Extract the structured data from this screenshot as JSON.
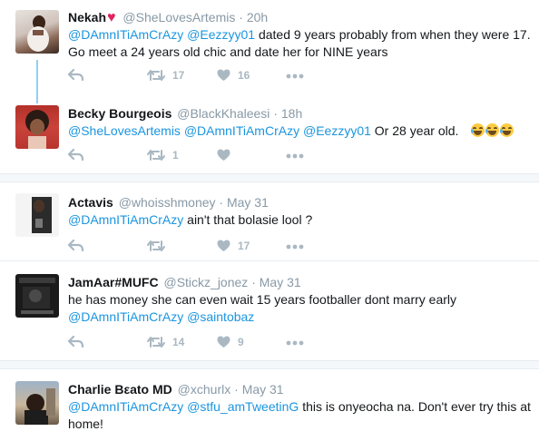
{
  "tweets": [
    {
      "name": "Nekah",
      "name_suffix": "♥",
      "handle": "@SheLovesArtemis",
      "dot": "·",
      "time": "20h",
      "mention1": "@DAmnITiAmCrAzy",
      "mention2": "@Eezzyy01",
      "text": " dated 9 years probably from when they were 17. Go meet a 24 years old chic and date her for NINE years",
      "retweets": "17",
      "likes": "16"
    },
    {
      "name": "Becky Bourgeois",
      "handle": "@BlackKhaleesi",
      "dot": "·",
      "time": "18h",
      "mention1": "@SheLovesArtemis",
      "mention2": "@DAmnITiAmCrAzy",
      "mention3": "@Eezzyy01",
      "text": " Or 28 year old.",
      "retweets": "1",
      "likes": ""
    },
    {
      "name": "Actavis",
      "handle": "@whoisshmoney",
      "dot": "·",
      "time": "May 31",
      "mention1": "@DAmnITiAmCrAzy",
      "text": " ain't that bolasie lool ?",
      "retweets": "",
      "likes": "17"
    },
    {
      "name": "JamAar#MUFC",
      "handle": "@Stickz_jonez",
      "dot": "·",
      "time": "May 31",
      "text": "he has money she can even wait 15 years footballer dont marry early",
      "mention1": "@DAmnITiAmCrAzy",
      "mention2": "@saintobaz",
      "retweets": "14",
      "likes": "9"
    },
    {
      "name": "Charlie Bεato MD",
      "handle": "@xchurlx",
      "dot": "·",
      "time": "May 31",
      "mention1": "@DAmnITiAmCrAzy",
      "mention2": "@stfu_amTweetinG",
      "text": " this is  onyeocha na. Don't ever try this at home!"
    }
  ],
  "colors": {
    "mention": "#1b95e0",
    "heart": "#e0245e",
    "muted": "#8899a6",
    "icon": "#aab8c2"
  },
  "icons": [
    "reply-icon",
    "retweet-icon",
    "like-icon",
    "more-icon",
    "heart-emoji",
    "laughing-tears-emoji"
  ]
}
